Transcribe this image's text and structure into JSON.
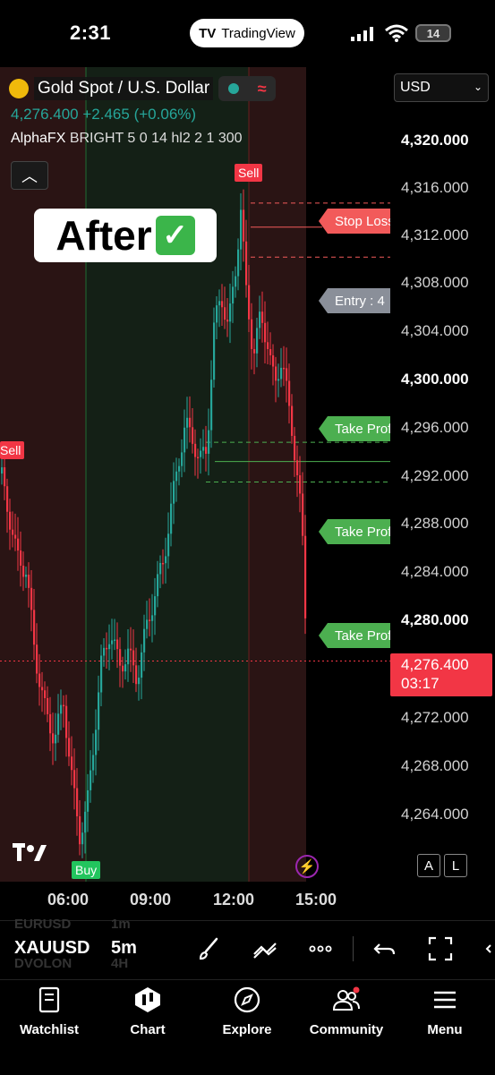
{
  "status_bar": {
    "time": "2:31",
    "app_pill": "TradingView",
    "battery": "14"
  },
  "symbol": {
    "title": "Gold Spot / U.S. Dollar",
    "price": "4,276.400",
    "change": "+2.465",
    "change_pct": "(+0.06%)"
  },
  "indicator": {
    "name": "AlphaFX",
    "params": "BRIGHT 5 0 14 hl2 2 1 300"
  },
  "badge": {
    "text": "After",
    "check": "✓"
  },
  "currency": "USD",
  "price_axis": {
    "ticks": [
      "4,320.000",
      "4,316.000",
      "4,312.000",
      "4,308.000",
      "4,304.000",
      "4,300.000",
      "4,296.000",
      "4,292.000",
      "4,288.000",
      "4,284.000",
      "4,280.000",
      "4,276.400",
      "4,272.000",
      "4,268.000",
      "4,264.000"
    ],
    "current_price": "4,276.400",
    "countdown": "03:17",
    "colors": {
      "up": "#26a69a",
      "down": "#f23645"
    }
  },
  "time_axis": [
    "06:00",
    "09:00",
    "12:00",
    "15:00"
  ],
  "trade_labels": {
    "sell_top": "Sell",
    "sell_left": "Sell",
    "buy": "Buy",
    "stop_loss": "Stop Loss",
    "entry": "Entry : 4",
    "tp1": "Take Profit",
    "tp2": "Take Profit",
    "tp3": "Take Profit"
  },
  "chart_controls": {
    "auto": "A",
    "log": "L"
  },
  "toolbar": {
    "symbol": "XAUUSD",
    "symbol_above": "EURUSD",
    "symbol_below": "DVOLON",
    "interval": "5m",
    "interval_above": "1m",
    "interval_below": "4H"
  },
  "tabs": [
    {
      "label": "Watchlist",
      "icon": "book-icon"
    },
    {
      "label": "Chart",
      "icon": "candles-icon"
    },
    {
      "label": "Explore",
      "icon": "compass-icon"
    },
    {
      "label": "Community",
      "icon": "people-icon"
    },
    {
      "label": "Menu",
      "icon": "menu-icon"
    }
  ]
}
